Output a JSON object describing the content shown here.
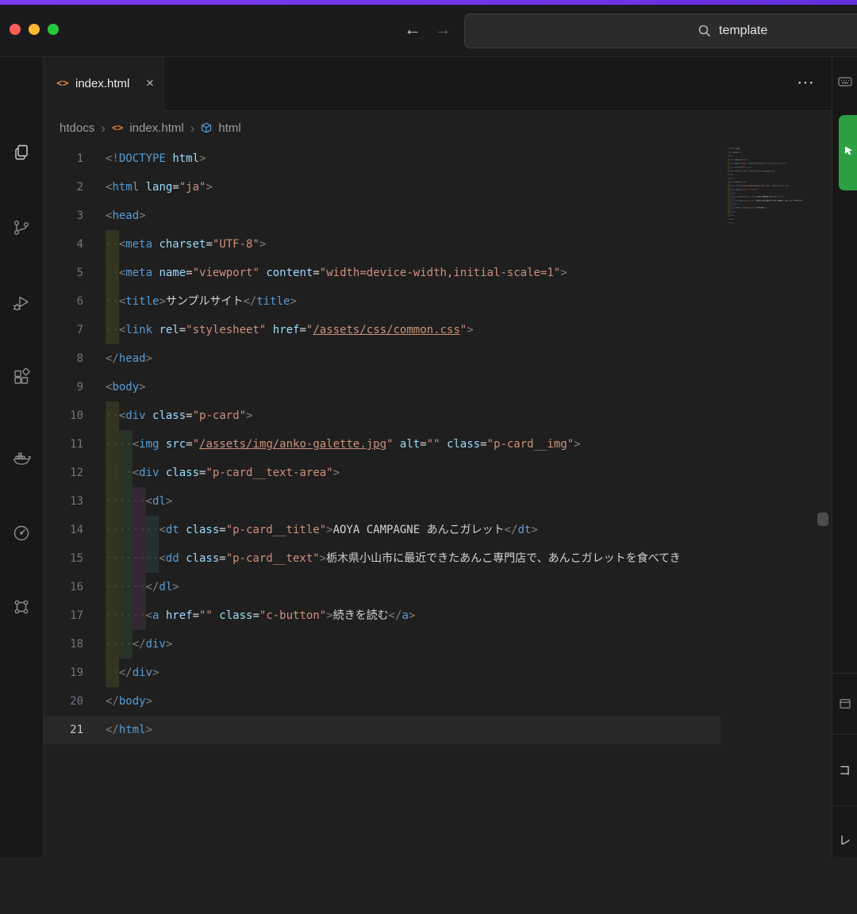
{
  "titlebar": {
    "search_text": "template",
    "back_glyph": "←",
    "forward_glyph": "→"
  },
  "activity_bar": {
    "icons": [
      "explorer",
      "source-control",
      "run-and-debug",
      "extensions",
      "docker",
      "gauge",
      "dots-grid"
    ]
  },
  "tabs": {
    "active": {
      "label": "index.html",
      "icon_glyph": "<>",
      "close_glyph": "×"
    },
    "more_actions": "⋯"
  },
  "breadcrumb": {
    "folder": "htdocs",
    "file": "index.html",
    "symbol": "html",
    "separator": "›",
    "file_icon_glyph": "<>"
  },
  "aux_bar": {
    "labels": [
      "コ",
      "レ"
    ]
  },
  "colors": {
    "accent_strip": "#7d3bf2",
    "tag": "#569cd6",
    "attribute": "#9cdcfe",
    "string": "#ce9178",
    "punctuation": "#808080",
    "html_icon": "#e0823d",
    "green_button": "#2ea043"
  },
  "editor": {
    "current_line": 21,
    "lines": [
      {
        "n": 1,
        "i": 0,
        "t": [
          [
            "p",
            "<!"
          ],
          [
            "t",
            "DOCTYPE"
          ],
          [
            "x",
            " "
          ],
          [
            "a",
            "html"
          ],
          [
            "p",
            ">"
          ]
        ]
      },
      {
        "n": 2,
        "i": 0,
        "t": [
          [
            "p",
            "<"
          ],
          [
            "t",
            "html"
          ],
          [
            "x",
            " "
          ],
          [
            "a",
            "lang"
          ],
          [
            "x",
            "="
          ],
          [
            "s",
            "\"ja\""
          ],
          [
            "p",
            ">"
          ]
        ]
      },
      {
        "n": 3,
        "i": 0,
        "t": [
          [
            "p",
            "<"
          ],
          [
            "t",
            "head"
          ],
          [
            "p",
            ">"
          ]
        ]
      },
      {
        "n": 4,
        "i": 1,
        "t": [
          [
            "p",
            "<"
          ],
          [
            "t",
            "meta"
          ],
          [
            "x",
            " "
          ],
          [
            "a",
            "charset"
          ],
          [
            "x",
            "="
          ],
          [
            "s",
            "\"UTF-8\""
          ],
          [
            "p",
            ">"
          ]
        ]
      },
      {
        "n": 5,
        "i": 1,
        "t": [
          [
            "p",
            "<"
          ],
          [
            "t",
            "meta"
          ],
          [
            "x",
            " "
          ],
          [
            "a",
            "name"
          ],
          [
            "x",
            "="
          ],
          [
            "s",
            "\"viewport\""
          ],
          [
            "x",
            " "
          ],
          [
            "a",
            "content"
          ],
          [
            "x",
            "="
          ],
          [
            "s",
            "\"width=device-width,initial-scale=1\""
          ],
          [
            "p",
            ">"
          ]
        ]
      },
      {
        "n": 6,
        "i": 1,
        "t": [
          [
            "p",
            "<"
          ],
          [
            "t",
            "title"
          ],
          [
            "p",
            ">"
          ],
          [
            "x",
            "サンプルサイト"
          ],
          [
            "p",
            "</"
          ],
          [
            "t",
            "title"
          ],
          [
            "p",
            ">"
          ]
        ]
      },
      {
        "n": 7,
        "i": 1,
        "t": [
          [
            "p",
            "<"
          ],
          [
            "t",
            "link"
          ],
          [
            "x",
            " "
          ],
          [
            "a",
            "rel"
          ],
          [
            "x",
            "="
          ],
          [
            "s",
            "\"stylesheet\""
          ],
          [
            "x",
            " "
          ],
          [
            "a",
            "href"
          ],
          [
            "x",
            "="
          ],
          [
            "s",
            "\""
          ],
          [
            "u",
            "/assets/css/common.css"
          ],
          [
            "s",
            "\""
          ],
          [
            "p",
            ">"
          ]
        ]
      },
      {
        "n": 8,
        "i": 0,
        "t": [
          [
            "p",
            "</"
          ],
          [
            "t",
            "head"
          ],
          [
            "p",
            ">"
          ]
        ]
      },
      {
        "n": 9,
        "i": 0,
        "t": [
          [
            "p",
            "<"
          ],
          [
            "t",
            "body"
          ],
          [
            "p",
            ">"
          ]
        ]
      },
      {
        "n": 10,
        "i": 1,
        "t": [
          [
            "p",
            "<"
          ],
          [
            "t",
            "div"
          ],
          [
            "x",
            " "
          ],
          [
            "a",
            "class"
          ],
          [
            "x",
            "="
          ],
          [
            "s",
            "\"p-card\""
          ],
          [
            "p",
            ">"
          ]
        ]
      },
      {
        "n": 11,
        "i": 2,
        "t": [
          [
            "p",
            "<"
          ],
          [
            "t",
            "img"
          ],
          [
            "x",
            " "
          ],
          [
            "a",
            "src"
          ],
          [
            "x",
            "="
          ],
          [
            "s",
            "\""
          ],
          [
            "u",
            "/assets/img/anko-galette.jpg"
          ],
          [
            "s",
            "\""
          ],
          [
            "x",
            " "
          ],
          [
            "a",
            "alt"
          ],
          [
            "x",
            "="
          ],
          [
            "s",
            "\"\""
          ],
          [
            "x",
            " "
          ],
          [
            "a",
            "class"
          ],
          [
            "x",
            "="
          ],
          [
            "s",
            "\"p-card__img\""
          ],
          [
            "p",
            ">"
          ]
        ]
      },
      {
        "n": 12,
        "i": 2,
        "t": [
          [
            "p",
            "<"
          ],
          [
            "t",
            "div"
          ],
          [
            "x",
            " "
          ],
          [
            "a",
            "class"
          ],
          [
            "x",
            "="
          ],
          [
            "s",
            "\"p-card__text-area\""
          ],
          [
            "p",
            ">"
          ]
        ]
      },
      {
        "n": 13,
        "i": 3,
        "t": [
          [
            "p",
            "<"
          ],
          [
            "t",
            "dl"
          ],
          [
            "p",
            ">"
          ]
        ]
      },
      {
        "n": 14,
        "i": 4,
        "t": [
          [
            "p",
            "<"
          ],
          [
            "t",
            "dt"
          ],
          [
            "x",
            " "
          ],
          [
            "a",
            "class"
          ],
          [
            "x",
            "="
          ],
          [
            "s",
            "\"p-card__title\""
          ],
          [
            "p",
            ">"
          ],
          [
            "x",
            "AOYA CAMPAGNE あんこガレット"
          ],
          [
            "p",
            "</"
          ],
          [
            "t",
            "dt"
          ],
          [
            "p",
            ">"
          ]
        ]
      },
      {
        "n": 15,
        "i": 4,
        "t": [
          [
            "p",
            "<"
          ],
          [
            "t",
            "dd"
          ],
          [
            "x",
            " "
          ],
          [
            "a",
            "class"
          ],
          [
            "x",
            "="
          ],
          [
            "s",
            "\"p-card__text\""
          ],
          [
            "p",
            ">"
          ],
          [
            "x",
            "栃木県小山市に最近できたあんこ専門店で、あんこガレットを食べてき"
          ]
        ]
      },
      {
        "n": 16,
        "i": 3,
        "t": [
          [
            "p",
            "</"
          ],
          [
            "t",
            "dl"
          ],
          [
            "p",
            ">"
          ]
        ]
      },
      {
        "n": 17,
        "i": 3,
        "t": [
          [
            "p",
            "<"
          ],
          [
            "t",
            "a"
          ],
          [
            "x",
            " "
          ],
          [
            "a",
            "href"
          ],
          [
            "x",
            "="
          ],
          [
            "s",
            "\"\""
          ],
          [
            "x",
            " "
          ],
          [
            "a",
            "class"
          ],
          [
            "x",
            "="
          ],
          [
            "s",
            "\"c-button\""
          ],
          [
            "p",
            ">"
          ],
          [
            "x",
            "続きを読む"
          ],
          [
            "p",
            "</"
          ],
          [
            "t",
            "a"
          ],
          [
            "p",
            ">"
          ]
        ]
      },
      {
        "n": 18,
        "i": 2,
        "t": [
          [
            "p",
            "</"
          ],
          [
            "t",
            "div"
          ],
          [
            "p",
            ">"
          ]
        ]
      },
      {
        "n": 19,
        "i": 1,
        "t": [
          [
            "p",
            "</"
          ],
          [
            "t",
            "div"
          ],
          [
            "p",
            ">"
          ]
        ]
      },
      {
        "n": 20,
        "i": 0,
        "t": [
          [
            "p",
            "</"
          ],
          [
            "t",
            "body"
          ],
          [
            "p",
            ">"
          ]
        ]
      },
      {
        "n": 21,
        "i": 0,
        "t": [
          [
            "p",
            "</"
          ],
          [
            "t",
            "html"
          ],
          [
            "p",
            ">"
          ]
        ]
      }
    ]
  }
}
